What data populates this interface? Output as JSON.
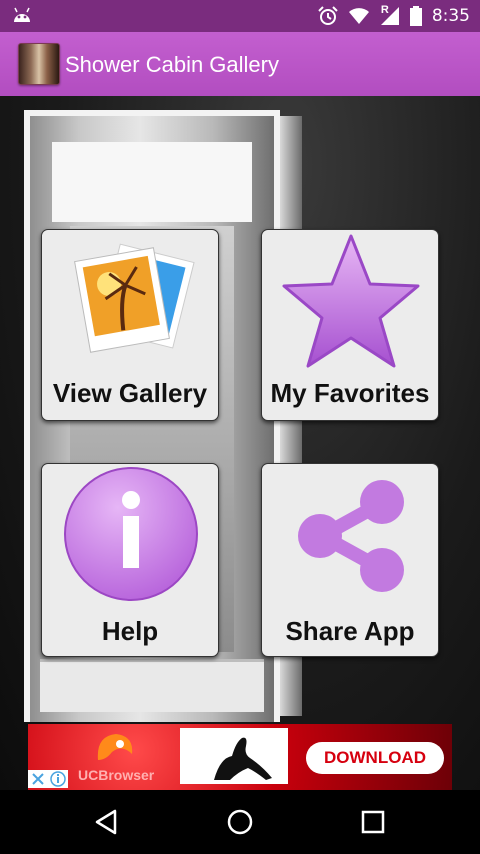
{
  "status_bar": {
    "time": "8:35",
    "network_label": "R",
    "icons": [
      "android-icon",
      "alarm-icon",
      "wifi-icon",
      "cell-signal-icon",
      "battery-icon"
    ]
  },
  "app_bar": {
    "title": "Shower Cabin Gallery",
    "icon": "shower-cabin-app-icon"
  },
  "tiles": [
    {
      "label": "View Gallery",
      "icon": "photos-icon"
    },
    {
      "label": "My Favorites",
      "icon": "star-icon"
    },
    {
      "label": "Help",
      "icon": "info-icon"
    },
    {
      "label": "Share App",
      "icon": "share-icon"
    }
  ],
  "ad": {
    "brand": "UCBrowser",
    "cta": "DOWNLOAD",
    "icons": [
      "close-icon",
      "adchoices-icon"
    ]
  },
  "nav_bar": {
    "buttons": [
      "back-icon",
      "home-icon",
      "recents-icon"
    ]
  },
  "colors": {
    "status_bar": "#7a2c7e",
    "app_bar": "#b24dc0",
    "tile_background": "#ececec",
    "icon_purple": "#c27ae0",
    "ad_red": "#c8000c"
  }
}
